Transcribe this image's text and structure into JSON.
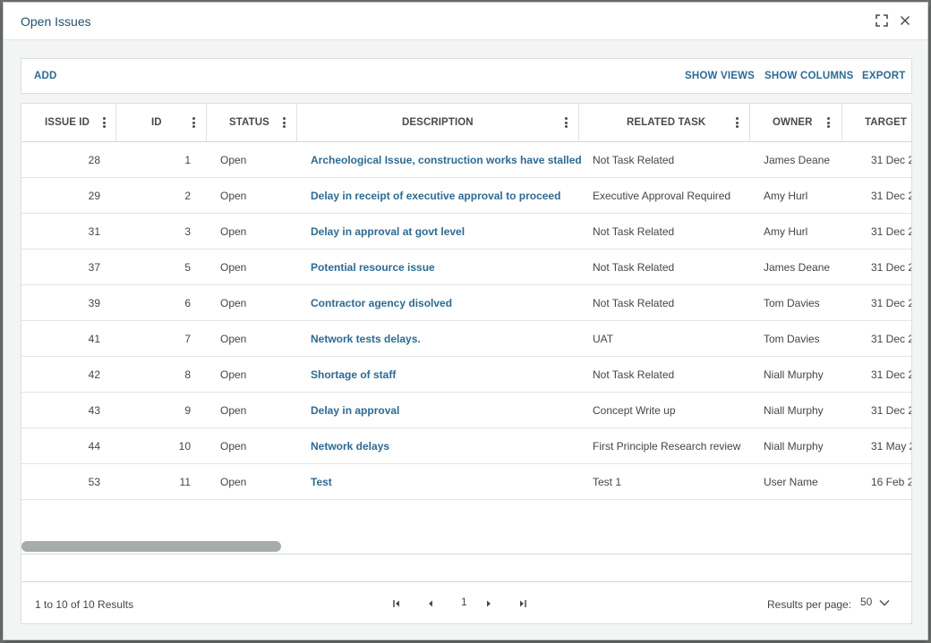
{
  "dialog": {
    "title": "Open Issues"
  },
  "toolbar": {
    "add_label": "ADD",
    "show_views_label": "SHOW VIEWS",
    "show_columns_label": "SHOW COLUMNS",
    "export_label": "EXPORT"
  },
  "table": {
    "columns": [
      "ISSUE ID",
      "ID",
      "STATUS",
      "DESCRIPTION",
      "RELATED TASK",
      "OWNER",
      "TARGET"
    ],
    "rows": [
      {
        "issue_id": "28",
        "id": "1",
        "status": "Open",
        "description": "Archeological Issue, construction works have stalled",
        "related_task": "Not Task Related",
        "owner": "James Deane",
        "target": "31 Dec 2"
      },
      {
        "issue_id": "29",
        "id": "2",
        "status": "Open",
        "description": "Delay in receipt of executive approval to proceed",
        "related_task": "Executive Approval Required",
        "owner": "Amy Hurl",
        "target": "31 Dec 2"
      },
      {
        "issue_id": "31",
        "id": "3",
        "status": "Open",
        "description": "Delay in approval at govt level",
        "related_task": "Not Task Related",
        "owner": "Amy Hurl",
        "target": "31 Dec 2"
      },
      {
        "issue_id": "37",
        "id": "5",
        "status": "Open",
        "description": "Potential resource issue",
        "related_task": "Not Task Related",
        "owner": "James Deane",
        "target": "31 Dec 2"
      },
      {
        "issue_id": "39",
        "id": "6",
        "status": "Open",
        "description": "Contractor agency disolved",
        "related_task": "Not Task Related",
        "owner": "Tom Davies",
        "target": "31 Dec 2"
      },
      {
        "issue_id": "41",
        "id": "7",
        "status": "Open",
        "description": "Network tests delays.",
        "related_task": "UAT",
        "owner": "Tom Davies",
        "target": "31 Dec 2"
      },
      {
        "issue_id": "42",
        "id": "8",
        "status": "Open",
        "description": "Shortage of staff",
        "related_task": "Not Task Related",
        "owner": "Niall Murphy",
        "target": "31 Dec 2"
      },
      {
        "issue_id": "43",
        "id": "9",
        "status": "Open",
        "description": "Delay in approval",
        "related_task": "Concept Write up",
        "owner": "Niall Murphy",
        "target": "31 Dec 2"
      },
      {
        "issue_id": "44",
        "id": "10",
        "status": "Open",
        "description": "Network delays",
        "related_task": "First Principle Research review",
        "owner": "Niall Murphy",
        "target": "31 May 2"
      },
      {
        "issue_id": "53",
        "id": "11",
        "status": "Open",
        "description": "Test",
        "related_task": "Test 1",
        "owner": "User Name",
        "target": "16 Feb 2"
      }
    ]
  },
  "footer": {
    "results_text": "1 to 10 of 10 Results",
    "current_page": "1",
    "results_per_page_label": "Results per page:",
    "results_per_page_value": "50"
  },
  "icons": {
    "maximize": "maximize-icon",
    "close": "close-icon",
    "column_menu": "kebab-icon",
    "first_page": "first-page-icon",
    "prev_page": "prev-page-icon",
    "next_page": "next-page-icon",
    "last_page": "last-page-icon",
    "dropdown": "chevron-down-icon"
  },
  "colors": {
    "link": "#2d6a93",
    "title": "#23506d",
    "scrollbar": "#a5acab"
  }
}
